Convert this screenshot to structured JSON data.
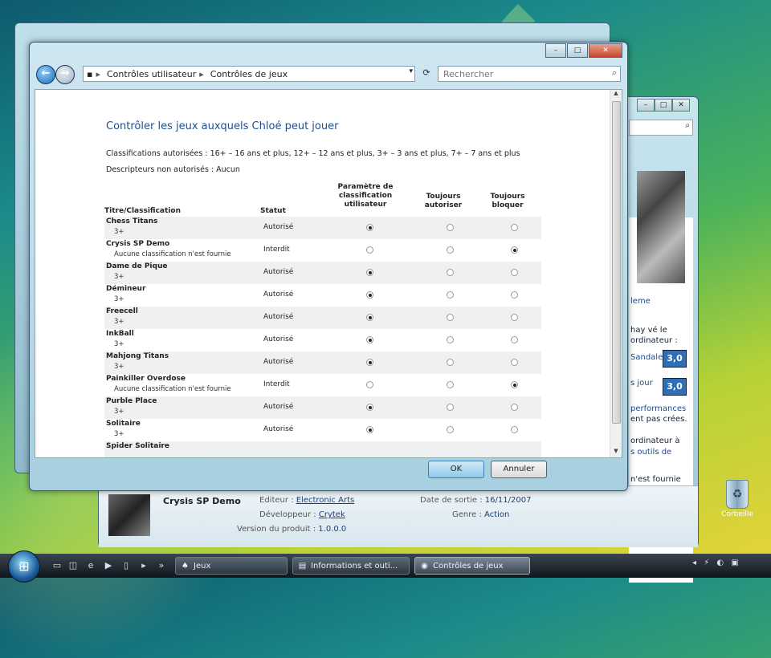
{
  "back_window": {},
  "right_window": {
    "side_texts": [
      "leme",
      "hay vé le",
      "ordinateur :",
      "Sandales",
      "s jour",
      "performances",
      "ent pas crées.",
      "ordinateur à",
      "s outils de",
      "n'est fournie"
    ],
    "scores": [
      "3,0",
      "3,0"
    ],
    "details": {
      "game_title": "Crysis SP Demo",
      "publisher_label": "Editeur :",
      "publisher_value": "Electronic Arts",
      "developer_label": "Développeur :",
      "developer_value": "Crytek",
      "version_label": "Version du produit :",
      "version_value": "1.0.0.0",
      "release_label": "Date de sortie :",
      "release_value": "16/11/2007",
      "genre_label": "Genre :",
      "genre_value": "Action"
    }
  },
  "dialog": {
    "caption_buttons": {
      "minimize": "–",
      "maximize": "□",
      "close": "✕"
    },
    "breadcrumb": [
      "Contrôles utilisateur",
      "Contrôles de jeux"
    ],
    "search_placeholder": "Rechercher",
    "heading": "Contrôler les jeux auxquels Chloé peut jouer",
    "classifications_line": "Classifications autorisées : 16+ – 16 ans et plus, 12+ – 12 ans et plus, 3+ – 3 ans et plus, 7+ – 7 ans et plus",
    "descriptors_line": "Descripteurs non autorisés : Aucun",
    "columns": {
      "title": "Titre/Classification",
      "status": "Statut",
      "user_setting": "Paramètre de classification utilisateur",
      "always_allow": "Toujours autoriser",
      "always_block": "Toujours bloquer"
    },
    "games": [
      {
        "title": "Chess Titans",
        "rating": "3+",
        "status": "Autorisé",
        "choice": 0
      },
      {
        "title": "Crysis SP Demo",
        "rating": "Aucune classification n'est fournie",
        "status": "Interdit",
        "choice": 2
      },
      {
        "title": "Dame de Pique",
        "rating": "3+",
        "status": "Autorisé",
        "choice": 0
      },
      {
        "title": "Démineur",
        "rating": "3+",
        "status": "Autorisé",
        "choice": 0
      },
      {
        "title": "Freecell",
        "rating": "3+",
        "status": "Autorisé",
        "choice": 0
      },
      {
        "title": "InkBall",
        "rating": "3+",
        "status": "Autorisé",
        "choice": 0
      },
      {
        "title": "Mahjong Titans",
        "rating": "3+",
        "status": "Autorisé",
        "choice": 0
      },
      {
        "title": "Painkiller Overdose",
        "rating": "Aucune classification n'est fournie",
        "status": "Interdit",
        "choice": 2
      },
      {
        "title": "Purble Place",
        "rating": "3+",
        "status": "Autorisé",
        "choice": 0
      },
      {
        "title": "Solitaire",
        "rating": "3+",
        "status": "Autorisé",
        "choice": 0
      },
      {
        "title": "Spider Solitaire",
        "rating": "",
        "status": "",
        "choice": -1
      }
    ],
    "ok_label": "OK",
    "cancel_label": "Annuler"
  },
  "desktop": {
    "recycle_bin_label": "Corbeille"
  },
  "taskbar": {
    "tasks": [
      {
        "label": "Jeux",
        "active": false
      },
      {
        "label": "Informations et outi...",
        "active": false
      },
      {
        "label": "Contrôles de jeux",
        "active": true
      }
    ]
  }
}
